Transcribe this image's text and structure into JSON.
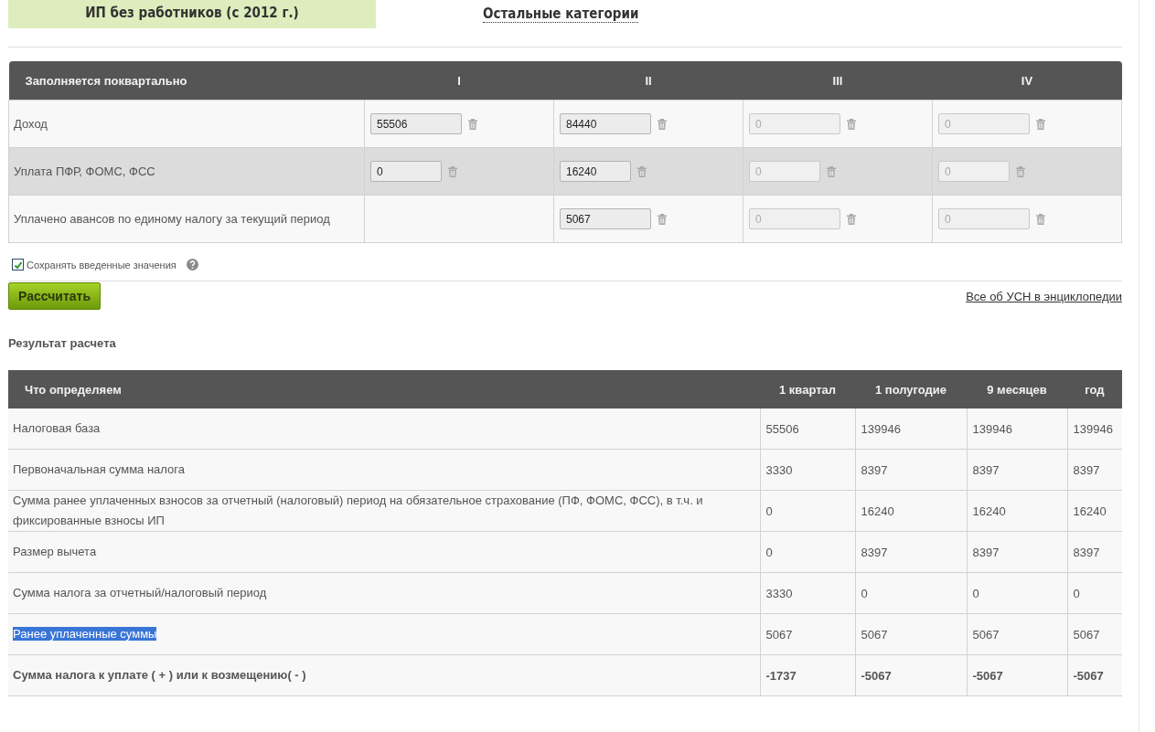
{
  "tabs": [
    {
      "label": "ИП без работников (с 2012 г.)",
      "selected": true
    },
    {
      "label": "Остальные категории",
      "selected": false
    }
  ],
  "input_table": {
    "header": "Заполняется поквартально",
    "quarters": [
      "I",
      "II",
      "III",
      "IV"
    ],
    "rows": [
      {
        "label": "Доход",
        "cells": [
          {
            "value": "55506",
            "disabled": false
          },
          {
            "value": "84440",
            "disabled": false
          },
          {
            "placeholder": "0",
            "disabled": true
          },
          {
            "placeholder": "0",
            "disabled": true
          }
        ]
      },
      {
        "label": "Уплата ПФР, ФОМС, ФСС",
        "cells": [
          {
            "value": "0",
            "disabled": false
          },
          {
            "value": "16240",
            "disabled": false
          },
          {
            "placeholder": "0",
            "disabled": true
          },
          {
            "placeholder": "0",
            "disabled": true
          }
        ]
      },
      {
        "label": "Уплачено авансов по единому налогу за текущий период",
        "cells": [
          null,
          {
            "value": "5067",
            "disabled": false
          },
          {
            "placeholder": "0",
            "disabled": true
          },
          {
            "placeholder": "0",
            "disabled": true
          }
        ]
      }
    ]
  },
  "save_checkbox": {
    "label": "Сохранять введенные значения",
    "checked": true
  },
  "calculate_button": "Рассчитать",
  "encyclopedia_link": "Все об УСН в энциклопедии",
  "result_title": "Результат расчета",
  "result_table": {
    "columns": [
      "Что определяем",
      "1 квартал",
      "1 полугодие",
      "9 месяцев",
      "год"
    ],
    "rows": [
      {
        "label": "Налоговая база",
        "values": [
          "55506",
          "139946",
          "139946",
          "139946"
        ],
        "highlighted": false,
        "kind": "normal"
      },
      {
        "label": "Первоначальная сумма налога",
        "values": [
          "3330",
          "8397",
          "8397",
          "8397"
        ],
        "highlighted": false,
        "kind": "normal"
      },
      {
        "label": "Сумма ранее уплаченных взносов за отчетный (налоговый) период на обязательное страхование (ПФ, ФОМС, ФСС), в т.ч. и фиксированные взносы ИП",
        "values": [
          "0",
          "16240",
          "16240",
          "16240"
        ],
        "highlighted": false,
        "kind": "normal"
      },
      {
        "label": "Размер вычета",
        "values": [
          "0",
          "8397",
          "8397",
          "8397"
        ],
        "highlighted": false,
        "kind": "normal"
      },
      {
        "label": "Сумма налога за отчетный/налоговый период",
        "values": [
          "3330",
          "0",
          "0",
          "0"
        ],
        "highlighted": false,
        "kind": "normal"
      },
      {
        "label": "Ранее уплаченные суммы",
        "values": [
          "5067",
          "5067",
          "5067",
          "5067"
        ],
        "highlighted": true,
        "kind": "normal"
      },
      {
        "label": "Сумма налога к уплате ( + ) или к возмещению( - )",
        "values": [
          "-1737",
          "-5067",
          "-5067",
          "-5067"
        ],
        "highlighted": false,
        "kind": "total"
      }
    ]
  }
}
